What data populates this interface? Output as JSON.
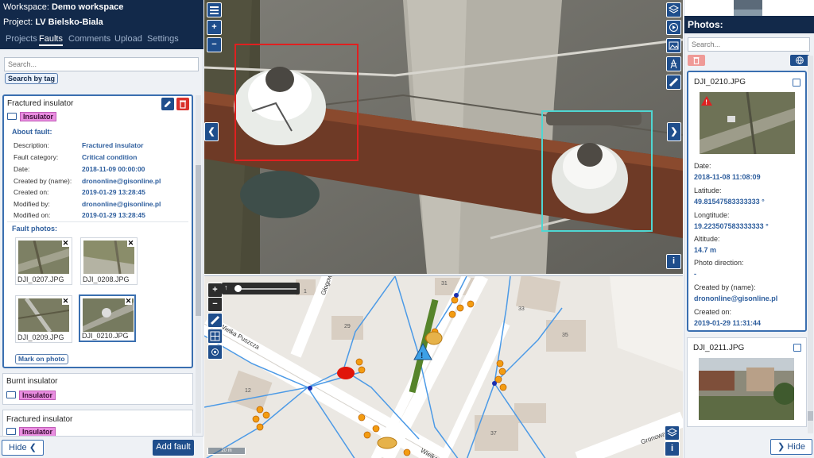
{
  "left": {
    "workspace_label": "Workspace:",
    "workspace_name": "Demo workspace",
    "project_label": "Project:",
    "project_name": "LV Bielsko-Biala",
    "tabs": [
      "Projects",
      "Faults",
      "Comments",
      "Upload",
      "Settings"
    ],
    "active_tab": "Faults",
    "search_placeholder": "Search...",
    "search_by_tag": "Search by tag",
    "selected_fault": {
      "title": "Fractured insulator",
      "tag": "Insulator",
      "about_heading": "About fault:",
      "details": [
        {
          "label": "Description:",
          "value": "Fractured insulator"
        },
        {
          "label": "Fault category:",
          "value": "Critical condition"
        },
        {
          "label": "Date:",
          "value": "2018-11-09 00:00:00"
        },
        {
          "label": "Created by (name):",
          "value": "drononline@gisonline.pl"
        },
        {
          "label": "Created on:",
          "value": "2019-01-29 13:28:45"
        },
        {
          "label": "Modified by:",
          "value": "drononline@gisonline.pl"
        },
        {
          "label": "Modified on:",
          "value": "2019-01-29 13:28:45"
        }
      ],
      "photos_heading": "Fault photos:",
      "photos": [
        "DJI_0207.JPG",
        "DJI_0208.JPG",
        "DJI_0209.JPG",
        "DJI_0210.JPG"
      ],
      "selected_photo": "DJI_0210.JPG",
      "mark_on_photo": "Mark on photo"
    },
    "other_faults": [
      {
        "title": "Burnt insulator",
        "tag": "Insulator"
      },
      {
        "title": "Fractured insulator",
        "tag": "Insulator"
      }
    ],
    "hide_label": "Hide",
    "add_fault_label": "Add fault"
  },
  "map": {
    "streets": [
      "Wielka Puszcza",
      "Głogowa",
      "Gronowa",
      "Wielka"
    ],
    "building_numbers": [
      "1",
      "29",
      "31",
      "33",
      "35",
      "12",
      "37"
    ],
    "scale_label": "20 m"
  },
  "right": {
    "heading": "Photos:",
    "search_placeholder": "Search...",
    "photos": [
      {
        "name": "DJI_0210.JPG",
        "fields": [
          {
            "label": "Date:",
            "value": "2018-11-08 11:08:09"
          },
          {
            "label": "Latitude:",
            "value": "49.81547583333333 °"
          },
          {
            "label": "Longtitude:",
            "value": "19.223507583333333 °"
          },
          {
            "label": "Altitude:",
            "value": "14.7 m"
          },
          {
            "label": "Photo direction:",
            "value": "-"
          },
          {
            "label": "Created by (name):",
            "value": "drononline@gisonline.pl"
          },
          {
            "label": "Created on:",
            "value": "2019-01-29 11:31:44"
          }
        ]
      },
      {
        "name": "DJI_0211.JPG"
      }
    ],
    "hide_label": "Hide"
  },
  "colors": {
    "header_navy": "#12294a",
    "accent_blue": "#1f4e8c",
    "tag_pink": "#e98de0",
    "danger_red": "#d9302b",
    "selection_red": "#e02020",
    "selection_cyan": "#4fd6d2"
  }
}
